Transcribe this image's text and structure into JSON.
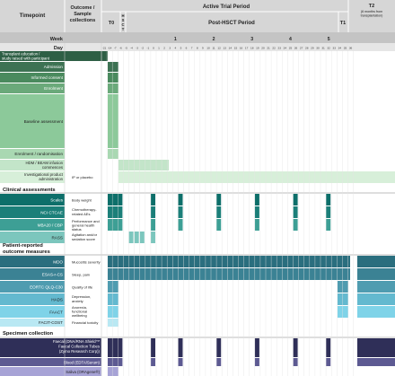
{
  "header": {
    "timepoint": "Timepoint",
    "outcome": [
      "Outcome /",
      "Sample",
      "collections"
    ],
    "active_period": "Active Trial Period",
    "t0": "T0",
    "hsct": [
      "H",
      "S",
      "C",
      "T"
    ],
    "post_period": "Post-HSCT Period",
    "t1": "T1",
    "t2": "T2",
    "t2_note": [
      "(6 months from",
      "transplantation)"
    ],
    "week_label": "Week",
    "day_label": "Day",
    "weeks": [
      "1",
      "2",
      "3",
      "4",
      "5"
    ],
    "days": [
      "-21",
      "-14",
      "-7",
      "-6",
      "-5",
      "-4",
      "-3",
      "-2",
      "-1",
      "0",
      "1",
      "2",
      "3",
      "4",
      "5",
      "6",
      "7",
      "8",
      "9",
      "10",
      "11",
      "12",
      "13",
      "14",
      "15",
      "16",
      "17",
      "18",
      "19",
      "20",
      "21",
      "22",
      "23",
      "24",
      "25",
      "26",
      "27",
      "28",
      "29",
      "30",
      "31",
      "32",
      "33",
      "34",
      "35",
      "36"
    ]
  },
  "sections": {
    "clinical": "Clinical assessments",
    "pro": [
      "Patient-reported",
      "outcome measures"
    ],
    "specimen": "Specimen collection"
  },
  "rows": {
    "transplant_ed": [
      "Transplant education /",
      "study raised with participant"
    ],
    "admission": "Admission",
    "informed_consent": "Informed consent",
    "eligibility": "Enrolment",
    "baseline": "Baseline assessment",
    "baseline_desc": [
      "Demographics,",
      "performance",
      "status and",
      "general health",
      "status, disease",
      "type/stage/grade,",
      "comorbidities,",
      "concurrent",
      "medication,",
      "treatment",
      "schedule"
    ],
    "enrolment": "Enrolment / randomisation",
    "hdm": [
      "HDM / BEAM infusion",
      "commences"
    ],
    "ipa": [
      "Investigational product",
      "administration"
    ],
    "ipa_desc": "IP or placebo",
    "scales": "Scales",
    "scales_desc": "Body weight",
    "ncictcae": "NCI CTCAE",
    "ncictcae_desc": [
      "Chemotherapy-",
      "related AEs"
    ],
    "mba": "MBA20 / CBP",
    "mba_desc": [
      "Performance and",
      "general health",
      "status"
    ],
    "rass": "RASS",
    "rass_desc": [
      "Agitation and/or",
      "sedation score"
    ],
    "mdo": "MDO",
    "mdo_desc": "Mucositis severity",
    "esas": "ESAS-r-CS",
    "esas_desc": "Sleep, pain",
    "eortc": "EORTC QLQ-C30",
    "eortc_desc": "Quality of life",
    "hads": "HADS",
    "hads_desc": [
      "Depression,",
      "anxiety"
    ],
    "faact": "FAACT",
    "faact_desc": [
      "Anorexia,",
      "functional",
      "wellbeing"
    ],
    "facit": "FACIT-COST",
    "facit_desc": "Financial toxicity",
    "faecal": [
      "Faecal (DNA/RNA Shield™",
      "Faecal Collection Tubes",
      "(Zymo Research Corp))"
    ],
    "blood": "Blood (EDTA/Serum)",
    "saliva": "Saliva (ORAgene®)"
  },
  "colors": {
    "dark_green": "#2e5f45",
    "mid_green": "#4a8a5e",
    "light_green": "#8cc99a",
    "pale_green": "#d7efd9",
    "teal_dark": "#0d6f6a",
    "teal": "#1e8f8a",
    "pro_dark": "#2a6e7e",
    "pro_light": "#7fd3e8",
    "navy": "#2f2f58",
    "purple": "#5d5a92",
    "lavender": "#a7a3d6",
    "header_gray": "#d6d6d6"
  }
}
